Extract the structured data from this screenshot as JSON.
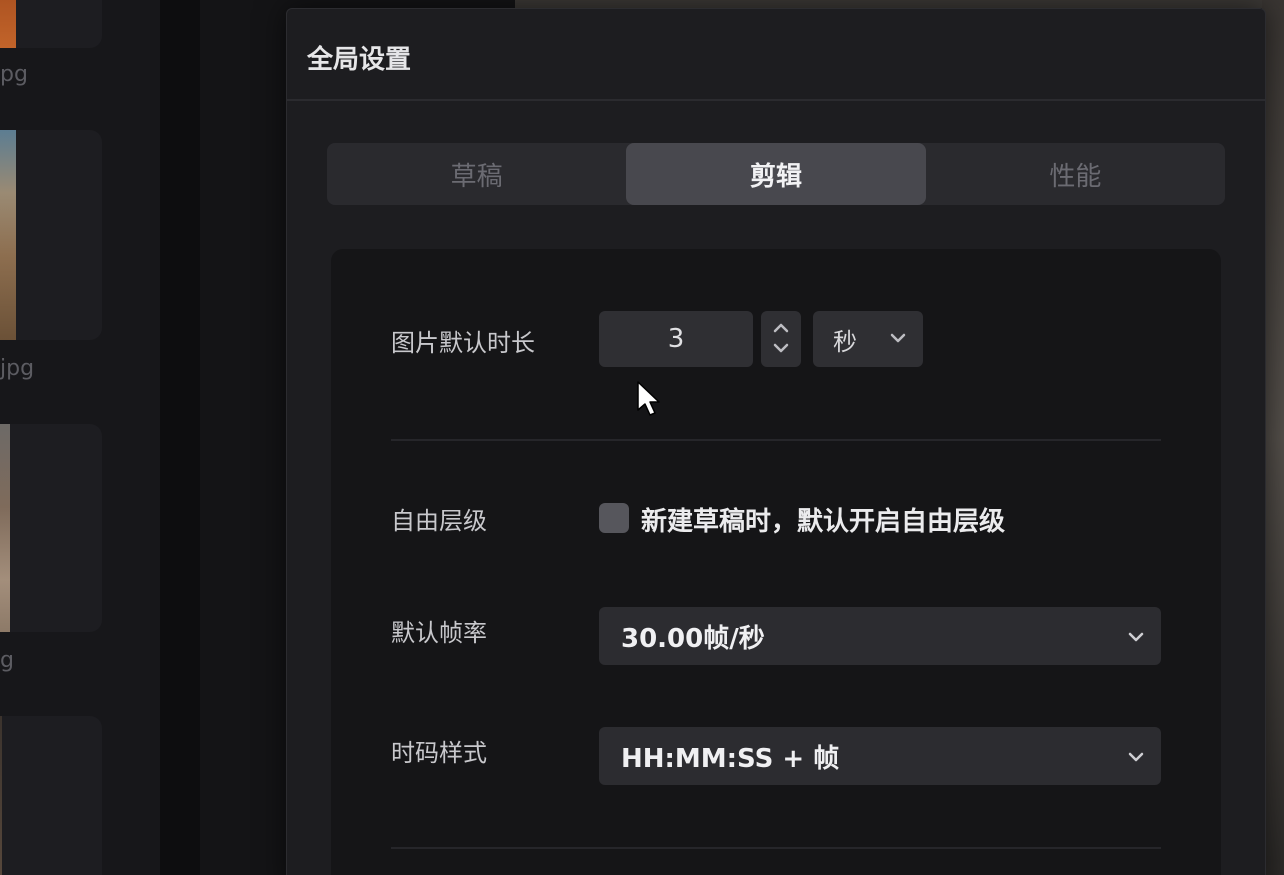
{
  "background": {
    "thumb_labels": [
      "pg",
      "jpg",
      "g"
    ]
  },
  "dialog": {
    "title": "全局设置",
    "tabs": [
      {
        "label": "草稿",
        "active": false
      },
      {
        "label": "剪辑",
        "active": true
      },
      {
        "label": "性能",
        "active": false
      }
    ],
    "settings": {
      "image_duration": {
        "label": "图片默认时长",
        "value": "3",
        "unit": "秒"
      },
      "free_layer": {
        "label": "自由层级",
        "checkbox_label": "新建草稿时，默认开启自由层级",
        "checked": false
      },
      "frame_rate": {
        "label": "默认帧率",
        "value": "30.00帧/秒"
      },
      "timecode": {
        "label": "时码样式",
        "value": "HH:MM:SS + 帧"
      }
    }
  },
  "icons": {
    "stepper": "up-down-chevron-icon",
    "dropdown": "chevron-down-icon",
    "cursor": "mouse-pointer-icon"
  },
  "colors": {
    "dialog_bg": "#1d1d20",
    "panel_bg": "#151517",
    "active_tab": "#48484e",
    "field_bg": "#2f2f33"
  }
}
